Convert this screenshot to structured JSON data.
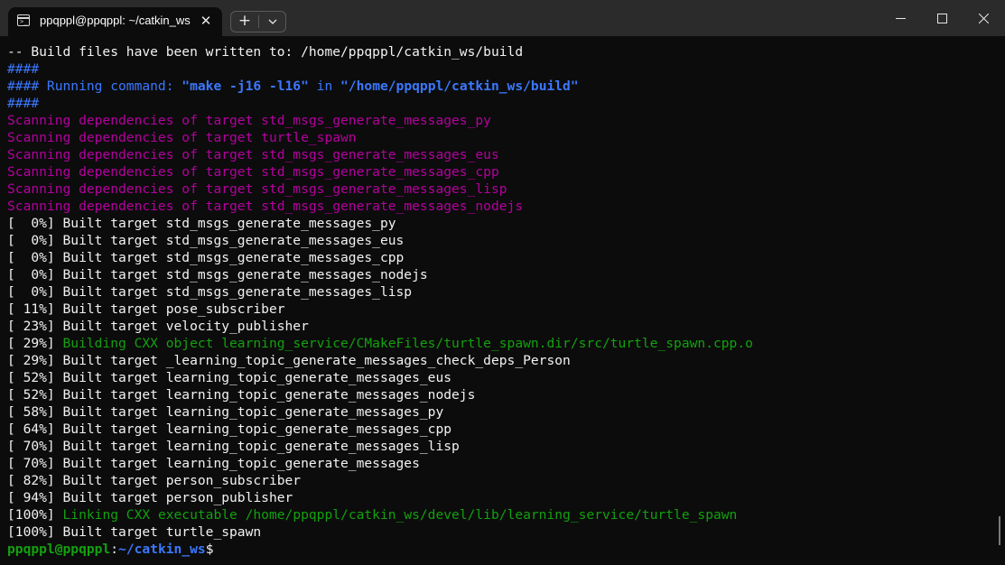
{
  "tab": {
    "title": "ppqppl@ppqppl: ~/catkin_ws",
    "close_glyph": "✕",
    "icon": "terminal-icon"
  },
  "toolbar": {
    "new_tab_glyph": "+",
    "dropdown_icon": "chevron-down-icon"
  },
  "window_controls": [
    "minimize-icon",
    "maximize-icon",
    "close-icon"
  ],
  "colors": {
    "background": "#0c0c0c",
    "titlebar": "#2b2b2b",
    "white": "#f2f2f2",
    "blue": "#3b78ff",
    "magenta": "#b4009e",
    "green": "#13a10e"
  },
  "output": [
    {
      "segments": [
        {
          "t": "-- Build files have been written to: /home/ppqppl/catkin_ws/build",
          "c": "white"
        }
      ]
    },
    {
      "segments": [
        {
          "t": "####",
          "c": "blue"
        }
      ]
    },
    {
      "segments": [
        {
          "t": "#### Running command: ",
          "c": "blue"
        },
        {
          "t": "\"make -j16 -l16\"",
          "c": "blue",
          "b": true
        },
        {
          "t": " in ",
          "c": "blue"
        },
        {
          "t": "\"/home/ppqppl/catkin_ws/build\"",
          "c": "blue",
          "b": true
        }
      ]
    },
    {
      "segments": [
        {
          "t": "####",
          "c": "blue"
        }
      ]
    },
    {
      "segments": [
        {
          "t": "Scanning dependencies of target std_msgs_generate_messages_py",
          "c": "magenta"
        }
      ]
    },
    {
      "segments": [
        {
          "t": "Scanning dependencies of target turtle_spawn",
          "c": "magenta"
        }
      ]
    },
    {
      "segments": [
        {
          "t": "Scanning dependencies of target std_msgs_generate_messages_eus",
          "c": "magenta"
        }
      ]
    },
    {
      "segments": [
        {
          "t": "Scanning dependencies of target std_msgs_generate_messages_cpp",
          "c": "magenta"
        }
      ]
    },
    {
      "segments": [
        {
          "t": "Scanning dependencies of target std_msgs_generate_messages_lisp",
          "c": "magenta"
        }
      ]
    },
    {
      "segments": [
        {
          "t": "Scanning dependencies of target std_msgs_generate_messages_nodejs",
          "c": "magenta"
        }
      ]
    },
    {
      "segments": [
        {
          "t": "[  0%] Built target std_msgs_generate_messages_py",
          "c": "white"
        }
      ]
    },
    {
      "segments": [
        {
          "t": "[  0%] Built target std_msgs_generate_messages_eus",
          "c": "white"
        }
      ]
    },
    {
      "segments": [
        {
          "t": "[  0%] Built target std_msgs_generate_messages_cpp",
          "c": "white"
        }
      ]
    },
    {
      "segments": [
        {
          "t": "[  0%] Built target std_msgs_generate_messages_nodejs",
          "c": "white"
        }
      ]
    },
    {
      "segments": [
        {
          "t": "[  0%] Built target std_msgs_generate_messages_lisp",
          "c": "white"
        }
      ]
    },
    {
      "segments": [
        {
          "t": "[ 11%] Built target pose_subscriber",
          "c": "white"
        }
      ]
    },
    {
      "segments": [
        {
          "t": "[ 23%] Built target velocity_publisher",
          "c": "white"
        }
      ]
    },
    {
      "segments": [
        {
          "t": "[ 29%] ",
          "c": "white"
        },
        {
          "t": "Building CXX object learning_service/CMakeFiles/turtle_spawn.dir/src/turtle_spawn.cpp.o",
          "c": "green"
        }
      ]
    },
    {
      "segments": [
        {
          "t": "[ 29%] Built target _learning_topic_generate_messages_check_deps_Person",
          "c": "white"
        }
      ]
    },
    {
      "segments": [
        {
          "t": "[ 52%] Built target learning_topic_generate_messages_eus",
          "c": "white"
        }
      ]
    },
    {
      "segments": [
        {
          "t": "[ 52%] Built target learning_topic_generate_messages_nodejs",
          "c": "white"
        }
      ]
    },
    {
      "segments": [
        {
          "t": "[ 58%] Built target learning_topic_generate_messages_py",
          "c": "white"
        }
      ]
    },
    {
      "segments": [
        {
          "t": "[ 64%] Built target learning_topic_generate_messages_cpp",
          "c": "white"
        }
      ]
    },
    {
      "segments": [
        {
          "t": "[ 70%] Built target learning_topic_generate_messages_lisp",
          "c": "white"
        }
      ]
    },
    {
      "segments": [
        {
          "t": "[ 70%] Built target learning_topic_generate_messages",
          "c": "white"
        }
      ]
    },
    {
      "segments": [
        {
          "t": "[ 82%] Built target person_subscriber",
          "c": "white"
        }
      ]
    },
    {
      "segments": [
        {
          "t": "[ 94%] Built target person_publisher",
          "c": "white"
        }
      ]
    },
    {
      "segments": [
        {
          "t": "[100%] ",
          "c": "white"
        },
        {
          "t": "Linking CXX executable /home/ppqppl/catkin_ws/devel/lib/learning_service/turtle_spawn",
          "c": "green"
        }
      ]
    },
    {
      "segments": [
        {
          "t": "[100%] Built target turtle_spawn",
          "c": "white"
        }
      ]
    },
    {
      "segments": [
        {
          "t": "ppqppl@ppqppl",
          "c": "green",
          "b": true
        },
        {
          "t": ":",
          "c": "white"
        },
        {
          "t": "~/catkin_ws",
          "c": "blue",
          "b": true
        },
        {
          "t": "$",
          "c": "white"
        }
      ]
    }
  ]
}
